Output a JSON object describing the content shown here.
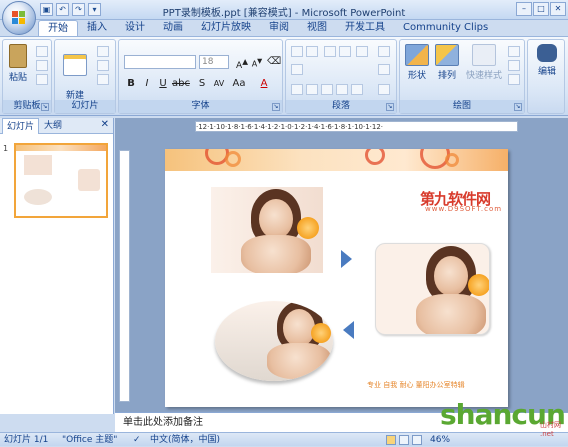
{
  "window": {
    "title": "PPT录制模板.ppt [兼容模式] - Microsoft PowerPoint"
  },
  "tabs": [
    "开始",
    "插入",
    "设计",
    "动画",
    "幻灯片放映",
    "审阅",
    "视图",
    "开发工具",
    "Community Clips"
  ],
  "ribbon": {
    "clipboard": {
      "label": "剪贴板",
      "paste": "粘贴"
    },
    "slides": {
      "label": "幻灯片",
      "new_slide": "新建\n幻灯片"
    },
    "font": {
      "label": "字体",
      "size": "18"
    },
    "paragraph": {
      "label": "段落"
    },
    "drawing": {
      "label": "绘图",
      "shape": "形状",
      "arrange": "排列",
      "quick_style": "快速样式"
    },
    "editing": {
      "label": "编辑"
    }
  },
  "left_pane": {
    "tab_slides": "幻灯片",
    "tab_outline": "大纲",
    "slide_number": "1"
  },
  "ruler_text": "·12·1·10·1·8·1·6·1·4·1·2·1·0·1·2·1·4·1·6·1·8·1·10·1·12·",
  "slide": {
    "watermark": "第九软件网",
    "watermark_sub": "www.D9SOFT.com",
    "footer": "专业  自我  耐心  董阳办公室特辑"
  },
  "notes": {
    "placeholder": "单击此处添加备注"
  },
  "status": {
    "slide": "幻灯片 1/1",
    "theme": "\"Office 主题\"",
    "lang": "中文(简体，中国)",
    "zoom": "46%"
  },
  "brand": {
    "name": "shancun",
    "sub": "山村网\n.net"
  },
  "colors": {
    "accent": "#15428b",
    "selection": "#f2a53a"
  }
}
